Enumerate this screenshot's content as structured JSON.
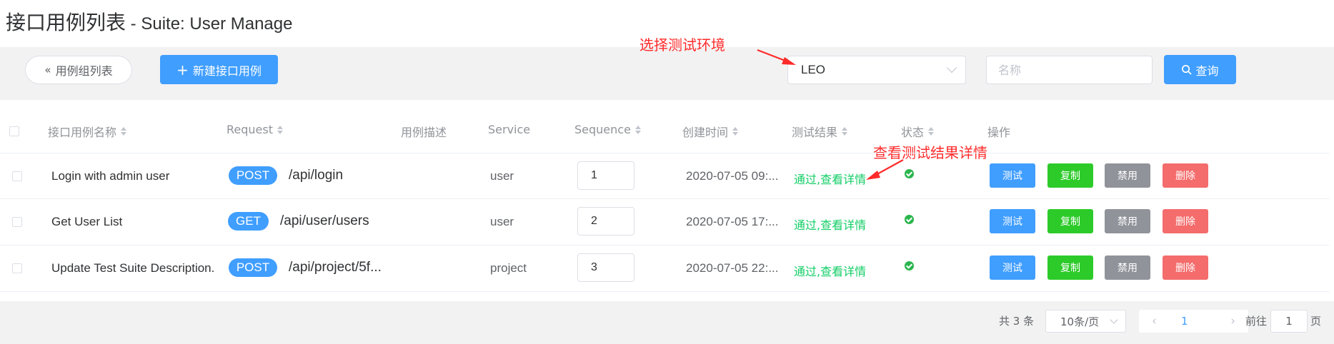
{
  "header": {
    "title": "接口用例列表",
    "suite": " - Suite: User Manage"
  },
  "toolbar": {
    "back_label": "用例组列表",
    "new_label": "新建接口用例",
    "env_value": "LEO",
    "name_placeholder": "名称",
    "search_label": "查询"
  },
  "annotations": {
    "env": "选择测试环境",
    "result": "查看测试结果详情",
    "color": "#ff2a2a"
  },
  "columns": [
    "接口用例名称",
    "Request",
    "用例描述",
    "Service",
    "Sequence",
    "创建时间",
    "测试结果",
    "状态",
    "操作"
  ],
  "rows": [
    {
      "name": "Login with admin user",
      "method": "POST",
      "path": "/api/login",
      "service": "user",
      "sequence": "1",
      "created": "2020-07-05 09:...",
      "result": "通过,查看详情"
    },
    {
      "name": "Get User List",
      "method": "GET",
      "path": "/api/user/users",
      "service": "user",
      "sequence": "2",
      "created": "2020-07-05 17:...",
      "result": "通过,查看详情"
    },
    {
      "name": "Update Test Suite Description.",
      "method": "POST",
      "path": "/api/project/5f...",
      "service": "project",
      "sequence": "3",
      "created": "2020-07-05 22:...",
      "result": "通过,查看详情"
    }
  ],
  "actions": {
    "test": "测试",
    "copy": "复制",
    "disable": "禁用",
    "delete": "删除"
  },
  "colors": {
    "primary": "#409eff",
    "success": "#13ce66",
    "copy": "#2dcb2a",
    "disable": "#909399",
    "delete": "#f46c6c"
  },
  "pagination": {
    "total_text": "共 3 条",
    "page_size": "10条/页",
    "current_page": "1",
    "goto_label": "前往",
    "goto_value": "1",
    "page_suffix": "页"
  }
}
